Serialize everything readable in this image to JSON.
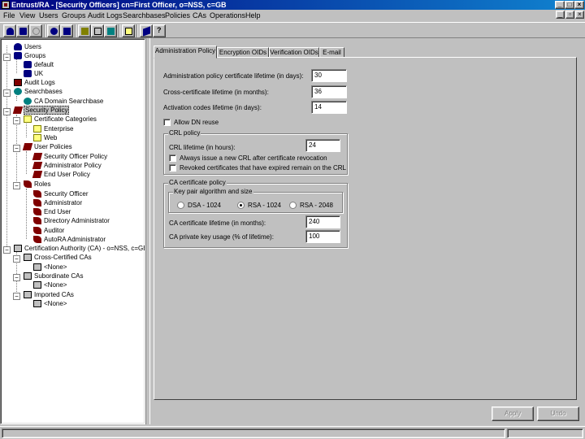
{
  "window": {
    "title": "Entrust/RA - [Security Officers] cn=First Officer, o=NSS, c=GB"
  },
  "menu": [
    {
      "label": "File"
    },
    {
      "label": "View"
    },
    {
      "label": "Users"
    },
    {
      "label": "Groups"
    },
    {
      "label": "Audit Logs"
    },
    {
      "label": "Searchbases"
    },
    {
      "label": "Policies"
    },
    {
      "label": "CAs"
    },
    {
      "label": "Operations"
    },
    {
      "label": "Help"
    }
  ],
  "toolbar": {
    "icons": [
      "new-user-icon",
      "groups-icon",
      "disabled-icon",
      "user-icon",
      "users-icon",
      "cert-icon",
      "tree-icon",
      "properties-icon",
      "lock-icon",
      "book-icon",
      "help-icon"
    ]
  },
  "tree": [
    {
      "label": "Users",
      "icon": "person-icon"
    },
    {
      "label": "Groups",
      "icon": "group-icon"
    },
    {
      "label": "default",
      "icon": "group-icon"
    },
    {
      "label": "UK",
      "icon": "group-icon"
    },
    {
      "label": "Audit Logs",
      "icon": "log-icon"
    },
    {
      "label": "Searchbases",
      "icon": "search-icon"
    },
    {
      "label": "CA Domain Searchbase",
      "icon": "search-icon"
    },
    {
      "label": "Security Policy",
      "icon": "policy-icon"
    },
    {
      "label": "Certificate Categories",
      "icon": "cert-icon"
    },
    {
      "label": "Enterprise",
      "icon": "cert-icon"
    },
    {
      "label": "Web",
      "icon": "cert-icon"
    },
    {
      "label": "User Policies",
      "icon": "policy-icon"
    },
    {
      "label": "Security Officer Policy",
      "icon": "policy-icon"
    },
    {
      "label": "Administrator Policy",
      "icon": "policy-icon"
    },
    {
      "label": "End User Policy",
      "icon": "policy-icon"
    },
    {
      "label": "Roles",
      "icon": "role-icon"
    },
    {
      "label": "Security Officer",
      "icon": "role-icon"
    },
    {
      "label": "Administrator",
      "icon": "role-icon"
    },
    {
      "label": "End User",
      "icon": "role-icon"
    },
    {
      "label": "Directory Administrator",
      "icon": "role-icon"
    },
    {
      "label": "Auditor",
      "icon": "role-icon"
    },
    {
      "label": "AutoRA Administrator",
      "icon": "role-icon"
    },
    {
      "label": "Certification Authority (CA) - o=NSS, c=GB",
      "icon": "ca-icon"
    },
    {
      "label": "Cross-Certified CAs",
      "icon": "ca-icon"
    },
    {
      "label": "<None>",
      "icon": "ca-icon"
    },
    {
      "label": "Subordinate CAs",
      "icon": "ca-icon"
    },
    {
      "label": "<None>",
      "icon": "ca-icon"
    },
    {
      "label": "Imported CAs",
      "icon": "ca-icon"
    },
    {
      "label": "<None>",
      "icon": "ca-icon"
    }
  ],
  "tabs": [
    {
      "label": "Administration Policy",
      "active": true
    },
    {
      "label": "Encryption OIDs",
      "active": false
    },
    {
      "label": "Verification OIDs",
      "active": false
    },
    {
      "label": "E-mail",
      "active": false
    }
  ],
  "admin": {
    "admin_cert_lifetime_label": "Administration policy certificate lifetime (in days):",
    "admin_cert_lifetime_value": "30",
    "cross_cert_lifetime_label": "Cross-certificate lifetime (in months):",
    "cross_cert_lifetime_value": "36",
    "activation_lifetime_label": "Activation codes lifetime (in days):",
    "activation_lifetime_value": "14",
    "allow_dn_reuse_label": "Allow DN reuse",
    "allow_dn_reuse_checked": false,
    "crl_group_label": "CRL policy",
    "crl_lifetime_label": "CRL lifetime (in hours):",
    "crl_lifetime_value": "24",
    "always_issue_crl_label": "Always issue a new CRL after certificate revocation",
    "always_issue_crl_checked": false,
    "revoked_expired_label": "Revoked certificates that have expired remain on the CRL",
    "revoked_expired_checked": false,
    "ca_cert_group_label": "CA certificate policy",
    "keypair_group_label": "Key pair algorithm and size",
    "key_options": [
      {
        "label": "DSA - 1024",
        "selected": false
      },
      {
        "label": "RSA - 1024",
        "selected": true
      },
      {
        "label": "RSA - 2048",
        "selected": false
      }
    ],
    "ca_cert_lifetime_label": "CA certificate lifetime (in months):",
    "ca_cert_lifetime_value": "240",
    "ca_private_key_label": "CA private key usage (% of lifetime):",
    "ca_private_key_value": "100"
  },
  "buttons": {
    "apply": "Apply",
    "undo": "Undo"
  }
}
